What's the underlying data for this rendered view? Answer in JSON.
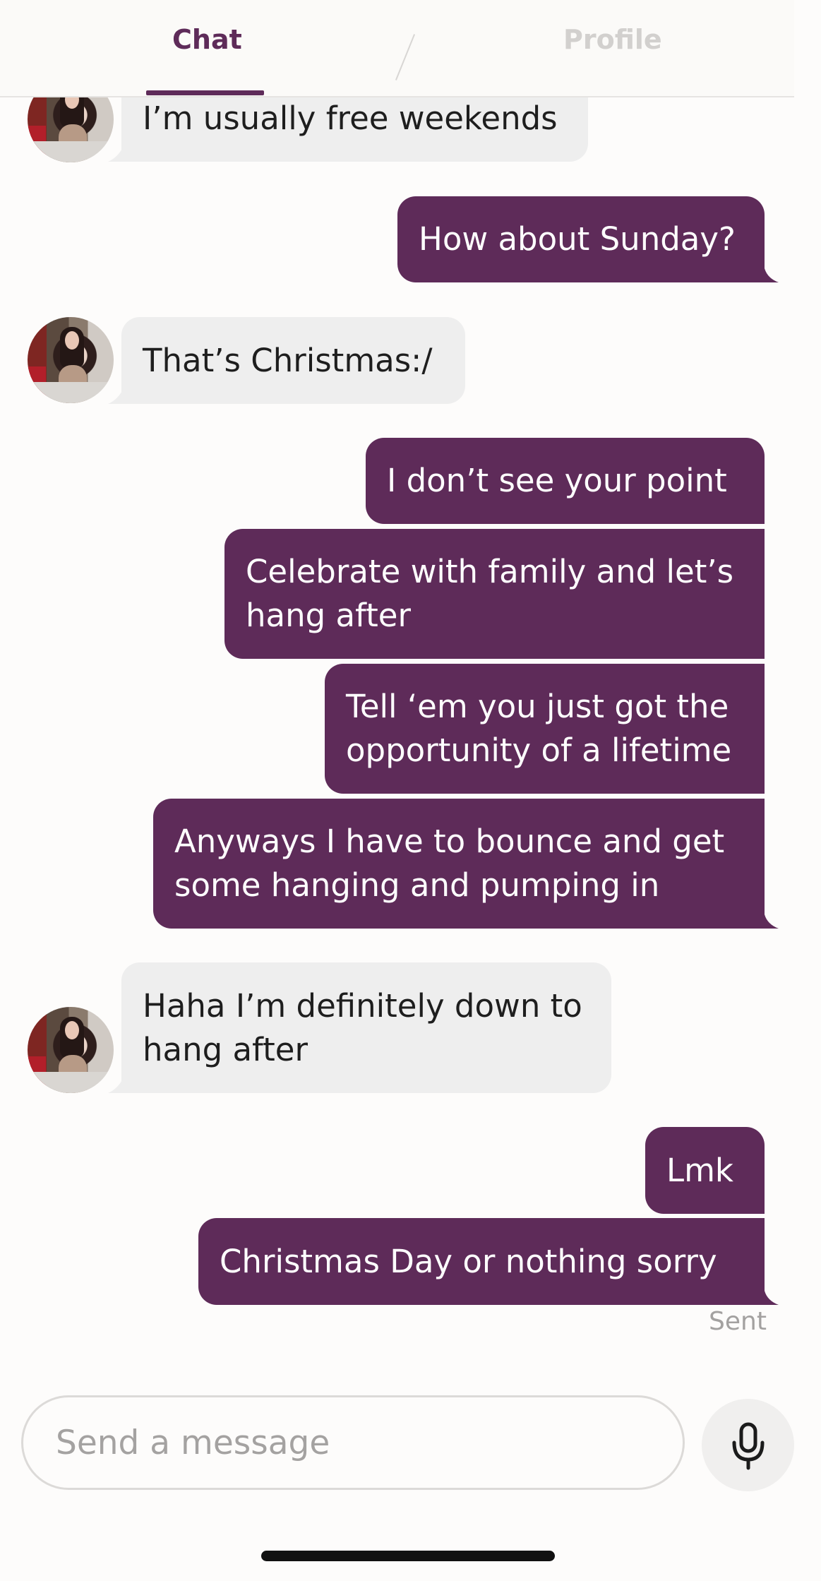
{
  "tabs": {
    "chat": "Chat",
    "profile": "Profile"
  },
  "messages": [
    {
      "from": "them",
      "text": "I’m usually free weekends"
    },
    {
      "from": "me",
      "text": "How about Sunday?"
    },
    {
      "from": "them",
      "text": "That’s Christmas:/"
    },
    {
      "from": "me",
      "text": "I don’t see your point"
    },
    {
      "from": "me",
      "text": "Celebrate with family and let’s\nhang after"
    },
    {
      "from": "me",
      "text": "Tell ‘em you just got the\nopportunity of a lifetime"
    },
    {
      "from": "me",
      "text": "Anyways I have to bounce and get\nsome hanging and pumping in"
    },
    {
      "from": "them",
      "text": "Haha I’m definitely down to\nhang after"
    },
    {
      "from": "me",
      "text": "Lmk"
    },
    {
      "from": "me",
      "text": "Christmas Day or nothing sorry"
    }
  ],
  "status": "Sent",
  "composer": {
    "placeholder": "Send a message",
    "mic_icon": "microphone-icon"
  },
  "colors": {
    "accent": "#5E2B59",
    "incoming_bubble": "#EEEEEE",
    "inactive_tab": "#D2D0CE"
  }
}
